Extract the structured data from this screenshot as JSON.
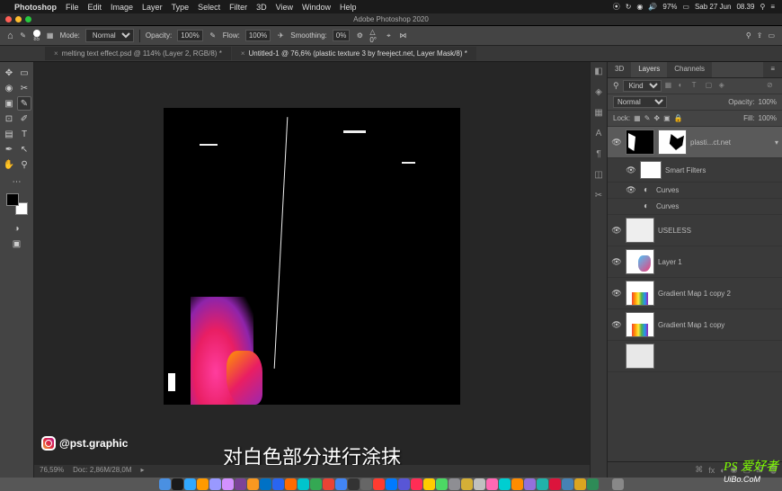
{
  "menubar": {
    "app": "Photoshop",
    "items": [
      "File",
      "Edit",
      "Image",
      "Layer",
      "Type",
      "Select",
      "Filter",
      "3D",
      "View",
      "Window",
      "Help"
    ],
    "battery": "97%",
    "date": "Sab 27 Jun",
    "time": "08.39"
  },
  "titlebar": {
    "title": "Adobe Photoshop 2020"
  },
  "optionsbar": {
    "mode_label": "Mode:",
    "mode": "Normal",
    "opacity_label": "Opacity:",
    "opacity": "100%",
    "flow_label": "Flow:",
    "flow": "100%",
    "smoothing_label": "Smoothing:",
    "smoothing": "0%",
    "brush_size": "85"
  },
  "tabs": [
    {
      "label": "melting text effect.psd @ 114% (Layer 2, RGB/8) *",
      "active": false
    },
    {
      "label": "Untitled-1 @ 76,6% (plastic texture 3 by freeject.net, Layer Mask/8) *",
      "active": true
    }
  ],
  "status": {
    "zoom": "76,59%",
    "doc": "Doc: 2,86M/28,0M"
  },
  "ig_handle": "@pst.graphic",
  "subtitle": "对白色部分进行涂抹",
  "layers_panel": {
    "tabs": [
      "3D",
      "Layers",
      "Channels"
    ],
    "active_tab": "Layers",
    "kind_label": "Kind",
    "blend": "Normal",
    "opacity_label": "Opacity:",
    "opacity": "100%",
    "lock_label": "Lock:",
    "fill_label": "Fill:",
    "fill": "100%",
    "layers": [
      {
        "name": "plasti...ct.net",
        "selected": true,
        "thumb": "mask",
        "visible": true
      },
      {
        "name": "Smart Filters",
        "sub": true,
        "visible": true,
        "thumb": "white"
      },
      {
        "name": "Curves",
        "sub": true,
        "adj": true,
        "visible": true
      },
      {
        "name": "Curves",
        "sub": true,
        "adj": true,
        "visible": false
      },
      {
        "name": "USELESS",
        "visible": true,
        "thumb": "light"
      },
      {
        "name": "Layer 1",
        "visible": true,
        "thumb": "blue-pink"
      },
      {
        "name": "Gradient Map 1 copy 2",
        "visible": true,
        "thumb": "rainbow"
      },
      {
        "name": "Gradient Map 1 copy",
        "visible": true,
        "thumb": "rainbow"
      }
    ]
  },
  "watermark": {
    "cn": "PS 爱好者",
    "url": "UiBo.CoM"
  },
  "dock_colors": [
    "#4a90e2",
    "#1a1a1a",
    "#31a8ff",
    "#ff9a00",
    "#9999ff",
    "#d291ff",
    "#7b4397",
    "#f89820",
    "#0071c5",
    "#2965f1",
    "#ff6b00",
    "#00c4cc",
    "#34a853",
    "#ea4335",
    "#4285f4",
    "#333",
    "#666",
    "#ff3b30",
    "#007aff",
    "#5856d6",
    "#ff2d55",
    "#ffcc00",
    "#4cd964",
    "#8e8e93",
    "#d4af37",
    "#c0c0c0",
    "#ff69b4",
    "#00ced1",
    "#ff8c00",
    "#9370db",
    "#20b2aa",
    "#dc143c",
    "#4682b4",
    "#daa520",
    "#2e8b57",
    "#555",
    "#888"
  ]
}
